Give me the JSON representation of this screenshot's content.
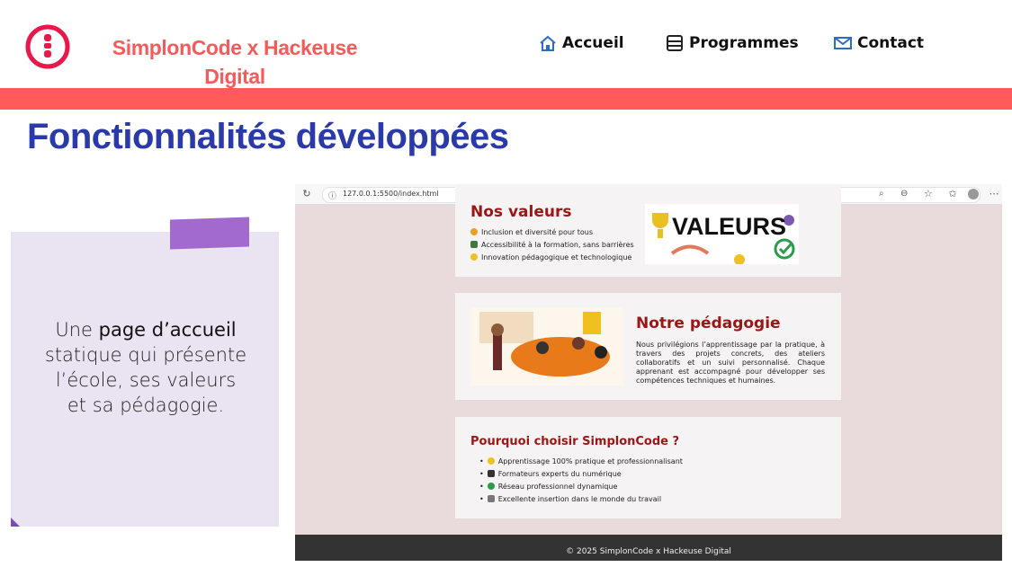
{
  "header": {
    "brand": "SimplonCode x Hackeuse Digital",
    "nav": [
      {
        "label": "Accueil",
        "icon": "home-icon"
      },
      {
        "label": "Programmes",
        "icon": "list-icon"
      },
      {
        "label": "Contact",
        "icon": "mail-icon"
      }
    ],
    "accent_color": "#fe5b5a"
  },
  "slide": {
    "title": "Fonctionnalités développées",
    "card": {
      "pre": "Une ",
      "bold": "page d’accueil",
      "post": " statique qui présente l’école, ses valeurs et sa pédagogie."
    }
  },
  "screenshot": {
    "url": "127.0.0.1:5500/index.html",
    "values": {
      "title": "Nos valeurs",
      "image_text": "VALEURS",
      "items": [
        "Inclusion et diversité pour tous",
        "Accessibilité à la formation, sans barrières",
        "Innovation pédagogique et technologique"
      ]
    },
    "pedagogy": {
      "title": "Notre pédagogie",
      "text": "Nous privilégions l’apprentissage par la pratique, à travers des projets concrets, des ateliers collaboratifs et un suivi personnalisé. Chaque apprenant est accompagné pour développer ses compétences techniques et humaines."
    },
    "why": {
      "title": "Pourquoi choisir SimplonCode ?",
      "items": [
        "Apprentissage 100% pratique et professionnalisant",
        "Formateurs experts du numérique",
        "Réseau professionnel dynamique",
        "Excellente insertion dans le monde du travail"
      ]
    },
    "footer": "© 2025 SimplonCode x Hackeuse Digital"
  }
}
